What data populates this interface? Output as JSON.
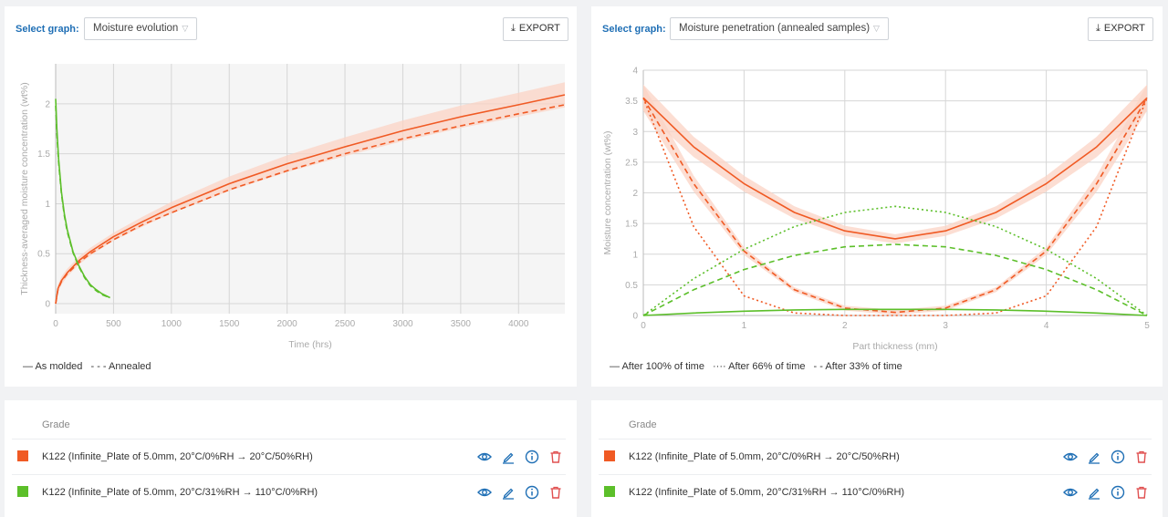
{
  "left_panel": {
    "select_label": "Select graph:",
    "selected_graph": "Moisture evolution",
    "export_label": "EXPORT",
    "legend": [
      "— As molded",
      "- - - Annealed"
    ]
  },
  "right_panel": {
    "select_label": "Select graph:",
    "selected_graph": "Moisture penetration (annealed samples)",
    "export_label": "EXPORT",
    "legend": [
      "— After 100% of time",
      "···· After 66% of time",
      "- - After 33% of time"
    ]
  },
  "colors": {
    "orange": "#f05a24",
    "green": "#5cbf2a",
    "band": "#fbd3c4",
    "accent": "#1f6fb5",
    "delete": "#e05050"
  },
  "grade_tables": [
    {
      "header": "Grade",
      "rows": [
        {
          "label": "K122 (Infinite_Plate of 5.0mm, 20°C/0%RH → 20°C/50%RH)",
          "color": "#f05a24"
        },
        {
          "label": "K122 (Infinite_Plate of 5.0mm, 20°C/31%RH → 110°C/0%RH)",
          "color": "#5cbf2a"
        }
      ],
      "row_icons": [
        "eye-icon",
        "edit-icon",
        "info-icon",
        "trash-icon"
      ]
    },
    {
      "header": "Grade",
      "rows": [
        {
          "label": "K122 (Infinite_Plate of 5.0mm, 20°C/0%RH → 20°C/50%RH)",
          "color": "#f05a24"
        },
        {
          "label": "K122 (Infinite_Plate of 5.0mm, 20°C/31%RH → 110°C/0%RH)",
          "color": "#5cbf2a"
        }
      ],
      "row_icons": [
        "eye-icon",
        "edit-icon",
        "info-icon",
        "trash-icon"
      ]
    }
  ],
  "chart_data": [
    {
      "type": "line",
      "xlabel": "Time (hrs)",
      "ylabel": "Thickness-averaged moisture concentration (wt%)",
      "xlim": [
        0,
        4400
      ],
      "ylim": [
        -0.1,
        2.4
      ],
      "xticks": [
        0,
        500,
        1000,
        1500,
        2000,
        2500,
        3000,
        3500,
        4000
      ],
      "yticks": [
        0,
        0.5,
        1,
        1.5,
        2
      ],
      "grid": true,
      "series": [
        {
          "name": "As molded",
          "color": "#f05a24",
          "style": "solid",
          "band": true,
          "x": [
            0,
            20,
            50,
            100,
            200,
            300,
            500,
            750,
            1000,
            1500,
            2000,
            2500,
            3000,
            3500,
            4000,
            4400
          ],
          "y": [
            0,
            0.15,
            0.23,
            0.31,
            0.43,
            0.52,
            0.67,
            0.82,
            0.96,
            1.2,
            1.4,
            1.57,
            1.73,
            1.87,
            1.99,
            2.09
          ]
        },
        {
          "name": "Annealed",
          "color": "#f05a24",
          "style": "dashed",
          "band": false,
          "x": [
            0,
            20,
            50,
            100,
            200,
            300,
            500,
            750,
            1000,
            1500,
            2000,
            2500,
            3000,
            3500,
            4000,
            4400
          ],
          "y": [
            0,
            0.14,
            0.22,
            0.3,
            0.41,
            0.5,
            0.64,
            0.79,
            0.91,
            1.14,
            1.33,
            1.5,
            1.65,
            1.78,
            1.9,
            1.99
          ]
        },
        {
          "name": "As molded",
          "color": "#5cbf2a",
          "style": "solid",
          "band": false,
          "x": [
            0,
            10,
            25,
            50,
            75,
            100,
            150,
            200,
            250,
            300,
            350,
            400,
            470
          ],
          "y": [
            2.05,
            1.75,
            1.45,
            1.12,
            0.9,
            0.74,
            0.52,
            0.38,
            0.27,
            0.19,
            0.14,
            0.1,
            0.06
          ]
        },
        {
          "name": "Annealed",
          "color": "#5cbf2a",
          "style": "dashed",
          "band": false,
          "x": [
            0,
            10,
            25,
            50,
            75,
            100,
            150,
            200,
            250,
            300,
            350,
            400,
            470
          ],
          "y": [
            1.98,
            1.7,
            1.42,
            1.1,
            0.88,
            0.72,
            0.51,
            0.37,
            0.26,
            0.18,
            0.13,
            0.09,
            0.06
          ]
        }
      ]
    },
    {
      "type": "line",
      "xlabel": "Part thickness (mm)",
      "ylabel": "Moisture concentration (wt%)",
      "xlim": [
        0,
        5
      ],
      "ylim": [
        0,
        4
      ],
      "xticks": [
        0,
        1,
        2,
        3,
        4,
        5
      ],
      "yticks": [
        0,
        0.5,
        1,
        1.5,
        2,
        2.5,
        3,
        3.5,
        4
      ],
      "grid": true,
      "series": [
        {
          "name": "After 100% of time",
          "color": "#f05a24",
          "style": "solid",
          "band": true,
          "x": [
            0,
            0.5,
            1,
            1.5,
            2,
            2.5,
            3,
            3.5,
            4,
            4.5,
            5
          ],
          "y": [
            3.55,
            2.75,
            2.15,
            1.68,
            1.38,
            1.25,
            1.38,
            1.68,
            2.15,
            2.75,
            3.55
          ]
        },
        {
          "name": "After 66% of time",
          "color": "#f05a24",
          "style": "dashed",
          "band": true,
          "x": [
            0,
            0.5,
            1,
            1.5,
            2,
            2.5,
            3,
            3.5,
            4,
            4.5,
            5
          ],
          "y": [
            3.55,
            2.15,
            1.05,
            0.42,
            0.12,
            0.05,
            0.12,
            0.42,
            1.05,
            2.15,
            3.55
          ]
        },
        {
          "name": "After 33% of time",
          "color": "#f05a24",
          "style": "dotted",
          "band": false,
          "x": [
            0,
            0.5,
            1,
            1.5,
            2,
            2.5,
            3,
            3.5,
            4,
            4.5,
            5
          ],
          "y": [
            3.55,
            1.45,
            0.32,
            0.04,
            0.0,
            0.0,
            0.0,
            0.04,
            0.32,
            1.45,
            3.55
          ]
        },
        {
          "name": "After 100% of time",
          "color": "#5cbf2a",
          "style": "solid",
          "band": false,
          "x": [
            0,
            0.5,
            1,
            1.5,
            2,
            2.5,
            3,
            3.5,
            4,
            4.5,
            5
          ],
          "y": [
            0,
            0.04,
            0.07,
            0.09,
            0.1,
            0.1,
            0.1,
            0.09,
            0.07,
            0.04,
            0
          ]
        },
        {
          "name": "After 66% of time",
          "color": "#5cbf2a",
          "style": "dashed",
          "band": false,
          "x": [
            0,
            0.5,
            1,
            1.5,
            2,
            2.5,
            3,
            3.5,
            4,
            4.5,
            5
          ],
          "y": [
            0,
            0.42,
            0.75,
            0.98,
            1.12,
            1.16,
            1.12,
            0.98,
            0.75,
            0.42,
            0
          ]
        },
        {
          "name": "After 33% of time",
          "color": "#5cbf2a",
          "style": "dotted",
          "band": false,
          "x": [
            0,
            0.5,
            1,
            1.5,
            2,
            2.5,
            3,
            3.5,
            4,
            4.5,
            5
          ],
          "y": [
            0,
            0.6,
            1.08,
            1.45,
            1.68,
            1.78,
            1.68,
            1.45,
            1.08,
            0.6,
            0
          ]
        }
      ]
    }
  ]
}
